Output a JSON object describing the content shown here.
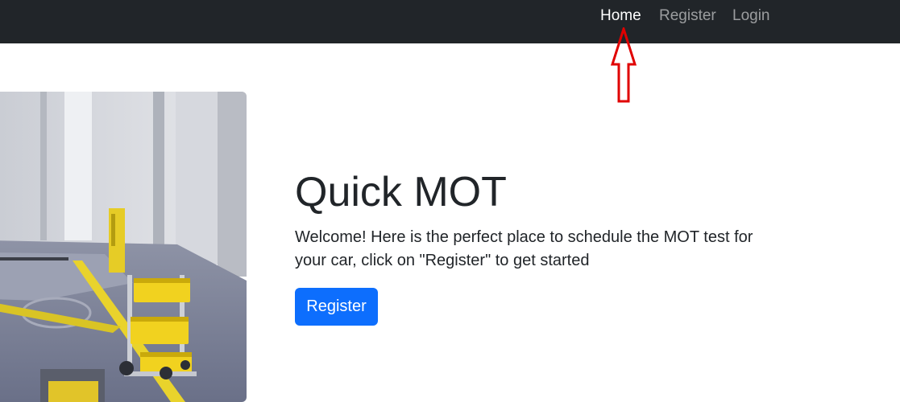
{
  "nav": {
    "links": [
      {
        "label": "Home",
        "active": true
      },
      {
        "label": "Register",
        "active": false
      },
      {
        "label": "Login",
        "active": false
      }
    ]
  },
  "hero": {
    "title": "Quick MOT",
    "lead": "Welcome! Here is the perfect place to schedule the MOT test for your car, click on \"Register\" to get started",
    "cta_label": "Register"
  },
  "colors": {
    "navbar_bg": "#212529",
    "primary": "#0d6efd",
    "annotation_arrow": "#e00000",
    "text": "#212529"
  },
  "icons": {
    "annotation": "red-outline-up-arrow-icon"
  }
}
